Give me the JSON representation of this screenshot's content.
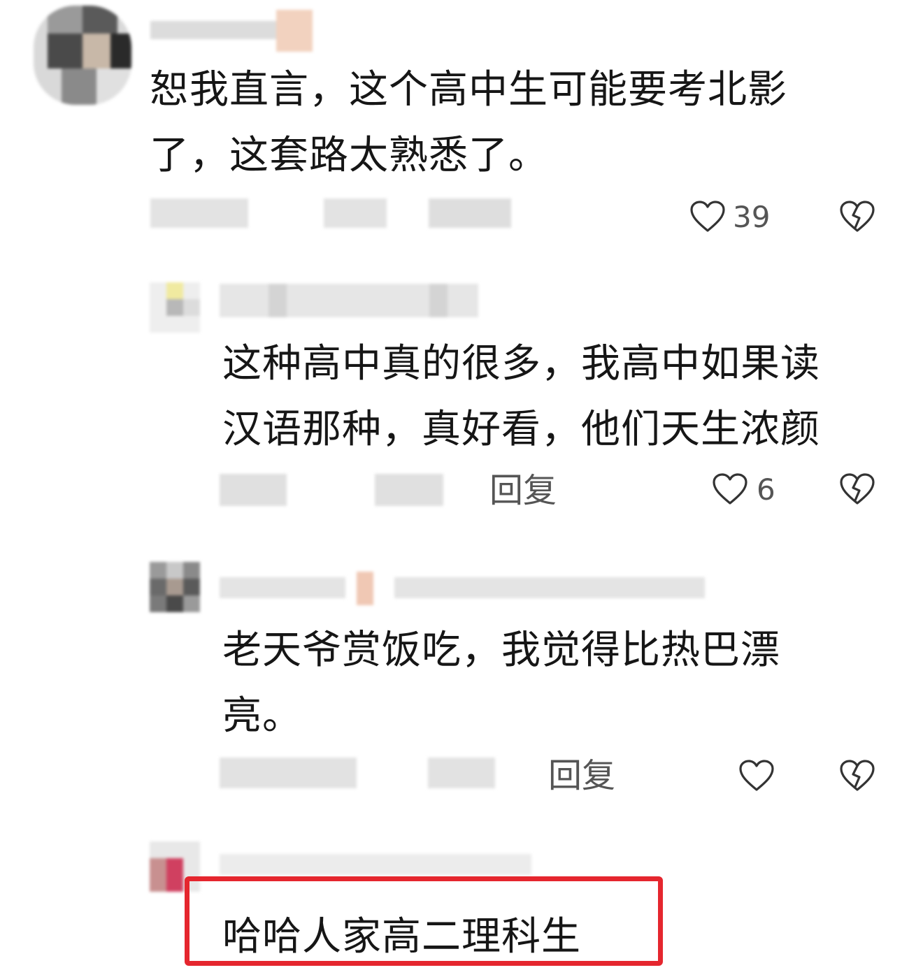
{
  "comments": [
    {
      "text_lines": [
        "恕我直言，这个高中生可能要考北影",
        "了，这套路太熟悉了。"
      ],
      "likes": "39",
      "reply_label": ""
    },
    {
      "text_lines": [
        "这种高中真的很多，我高中如果读",
        "汉语那种，真好看，他们天生浓颜"
      ],
      "likes": "6",
      "reply_label": "回复"
    },
    {
      "text_lines": [
        "老天爷赏饭吃，我觉得比热巴漂",
        "亮。"
      ],
      "likes": "",
      "reply_label": "回复"
    },
    {
      "text_lines": [
        "哈哈人家高二理科生"
      ],
      "likes": "",
      "reply_label": ""
    }
  ],
  "icons": {
    "like": "heart-outline-icon",
    "dislike": "broken-heart-icon"
  },
  "colors": {
    "highlight_border": "#e5262e",
    "text": "#161616",
    "meta_text": "#555555"
  }
}
